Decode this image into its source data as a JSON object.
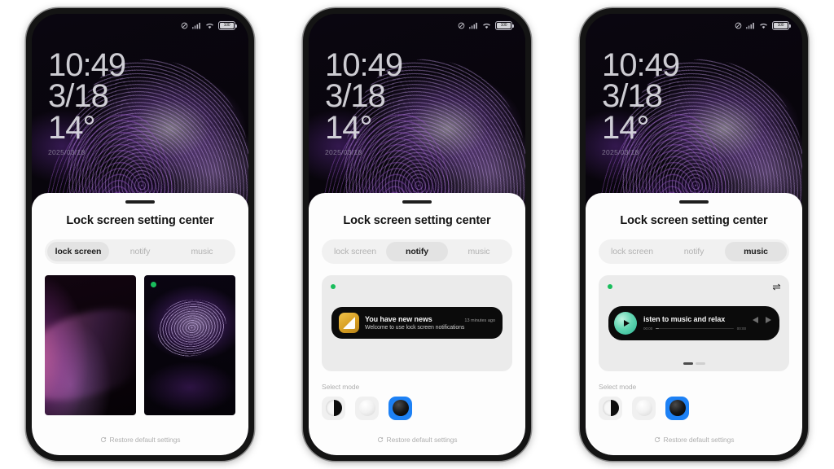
{
  "sheet": {
    "title": "Lock screen setting center",
    "drag_handle": "drag-handle",
    "restore_label": "Restore default settings",
    "restore_icon": "refresh-icon"
  },
  "tabs": [
    {
      "id": "lock-screen",
      "label": "lock screen"
    },
    {
      "id": "notify",
      "label": "notify"
    },
    {
      "id": "music",
      "label": "music"
    }
  ],
  "status_bar": {
    "dnd_icon": "do-not-disturb-icon",
    "signal_icon": "cellular-signal-icon",
    "wifi_icon": "wifi-icon",
    "battery_icon": "battery-icon",
    "battery_level": "100"
  },
  "lock_clock": {
    "time": "10:49",
    "date": "3/18",
    "temperature": "14°",
    "full_date": "2025/03/18"
  },
  "select_mode": {
    "label": "Select mode",
    "options": [
      {
        "id": "auto",
        "name": "mode-auto"
      },
      {
        "id": "light",
        "name": "mode-light"
      },
      {
        "id": "dark",
        "name": "mode-dark"
      }
    ],
    "selected": "dark",
    "selected_color": "#1d81f5"
  },
  "wallpapers": {
    "items": [
      {
        "id": "wallpaper-pink-smoke",
        "selected": false
      },
      {
        "id": "wallpaper-purple-lighttrail",
        "selected": true
      }
    ],
    "selected_dot_color": "#19bd5c"
  },
  "notification": {
    "status_dot_color": "#19bd5c",
    "app_icon": "news-app-icon",
    "title": "You have new news",
    "subtitle": "Welcome to use lock screen notifications",
    "time": "13 minutes ago"
  },
  "music": {
    "status_dot_color": "#19bd5c",
    "swap_icon": "shuffle-swap-icon",
    "play_icon": "play-icon",
    "prev_icon": "previous-track-icon",
    "next_icon": "next-track-icon",
    "title": "isten to music and relax",
    "elapsed": "00:00",
    "duration": "00:00",
    "page_dots": 2,
    "active_page": 0
  },
  "phones": [
    {
      "id": "phone-lock-screen",
      "active_tab": "lock-screen"
    },
    {
      "id": "phone-notify",
      "active_tab": "notify"
    },
    {
      "id": "phone-music",
      "active_tab": "music"
    }
  ]
}
